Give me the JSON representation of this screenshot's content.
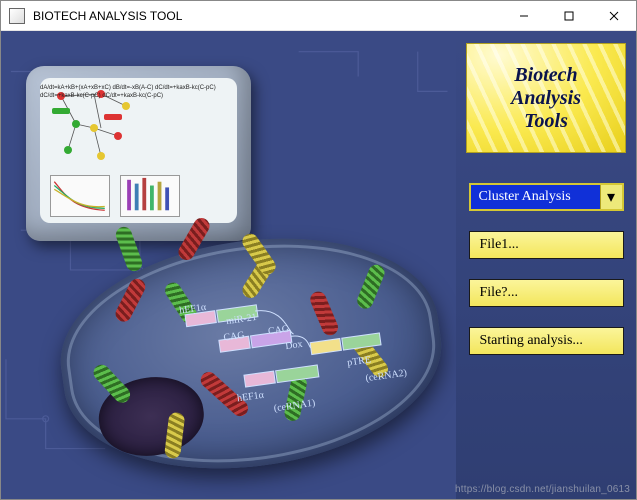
{
  "window": {
    "title": "BIOTECH ANALYSIS TOOL"
  },
  "logo": {
    "text": "Biotech\nAnalysis\nTools"
  },
  "side": {
    "dropdown": {
      "selected": "Cluster Analysis"
    },
    "file1_label": "File1...",
    "file2_label": "File?...",
    "start_label": "Starting analysis..."
  },
  "cell_labels": {
    "hef1a_top": "hEF1α",
    "mir21": "miR-21",
    "cag1": "CAG",
    "cag2": "CAG",
    "dox": "Dox",
    "ptre": "pTRE",
    "hef1a_bot": "hEF1α",
    "cerna1": "(ceRNA1)",
    "cerna2": "(ceRNA2)"
  },
  "screen_equations": "dA/dt=kA+kB+(xA+xB+xC)\ndB/dt=-xB(A-C)\ndC/dt=+kaxB-kc(C-pC)\ndC/dt=+kaxB-kc(C-pC)\ndC/dt=+kaxB-kc(C-pC)",
  "watermark": "https://blog.csdn.net/jianshuilan_0613"
}
